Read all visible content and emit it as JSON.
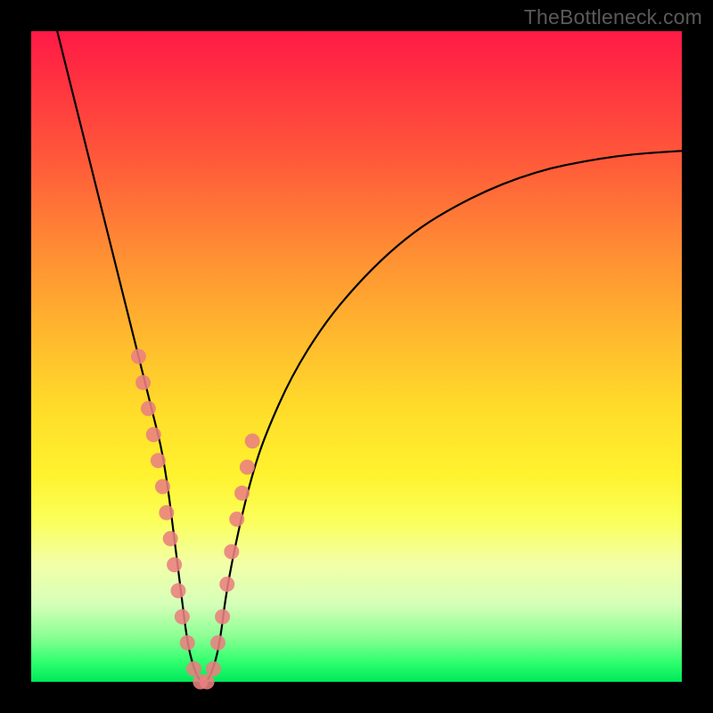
{
  "watermark": "TheBottleneck.com",
  "chart_data": {
    "type": "line",
    "title": "",
    "xlabel": "",
    "ylabel": "",
    "xlim": [
      0,
      100
    ],
    "ylim": [
      0,
      100
    ],
    "x": [
      4,
      6,
      8,
      10,
      12,
      14,
      16,
      18,
      19,
      20,
      21,
      22,
      23,
      24,
      25,
      26,
      27,
      28,
      29,
      30,
      32,
      34,
      36,
      40,
      45,
      50,
      55,
      60,
      65,
      70,
      75,
      80,
      85,
      90,
      95,
      100
    ],
    "values": [
      100,
      92,
      84,
      76,
      68,
      60,
      52,
      44,
      40,
      36,
      30,
      22,
      14,
      6,
      2,
      0,
      0,
      2,
      6,
      14,
      24,
      32,
      38,
      47,
      55,
      61,
      66,
      70,
      73,
      75.5,
      77.5,
      79,
      80,
      80.8,
      81.3,
      81.6
    ],
    "markers": {
      "x": [
        16.5,
        17.2,
        18.0,
        18.8,
        19.5,
        20.2,
        20.8,
        21.4,
        22.0,
        22.6,
        23.2,
        24.0,
        25.0,
        26.0,
        27.0,
        28.0,
        28.7,
        29.4,
        30.1,
        30.8,
        31.6,
        32.4,
        33.2,
        34.0
      ],
      "values": [
        50,
        46,
        42,
        38,
        34,
        30,
        26,
        22,
        18,
        14,
        10,
        6,
        2,
        0,
        0,
        2,
        6,
        10,
        15,
        20,
        25,
        29,
        33,
        37
      ],
      "color": "#e98080"
    },
    "curve_color": "#000000",
    "legend": []
  }
}
